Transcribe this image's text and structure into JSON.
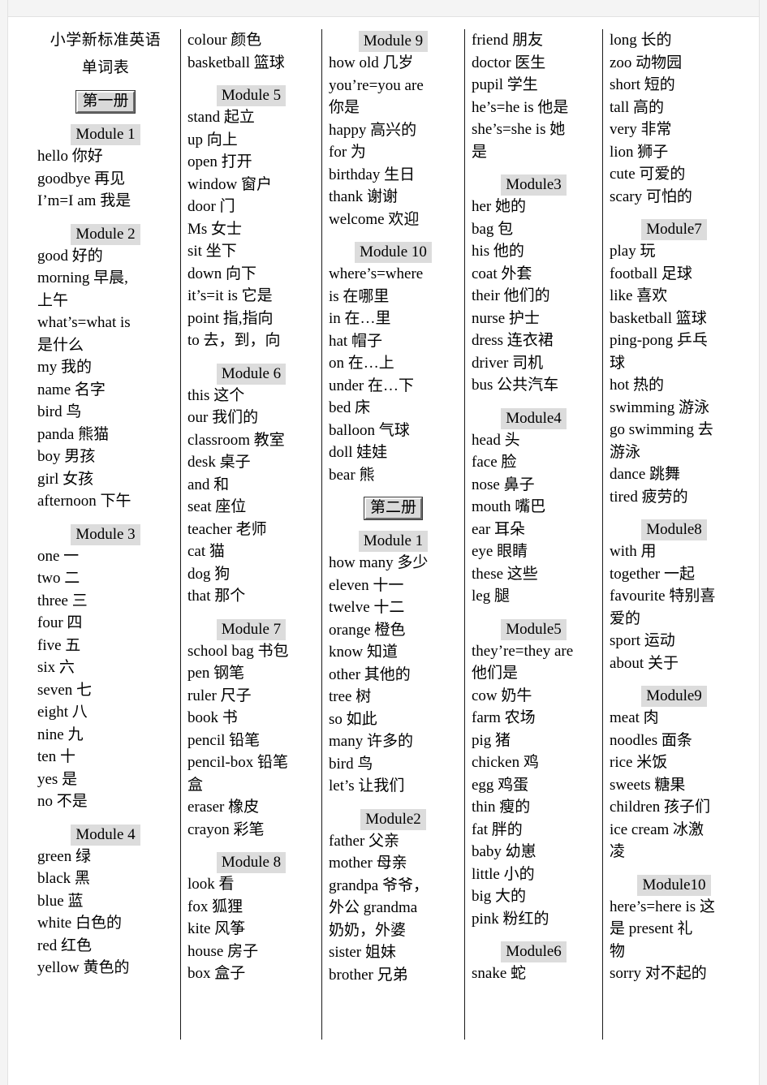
{
  "document": {
    "title_line1": "小学新标准英语",
    "title_line2": "单词表"
  },
  "volumes": {
    "book1": "第一册",
    "book2": "第二册"
  },
  "columns": [
    {
      "id": "column-1",
      "blocks": [
        {
          "type": "title"
        },
        {
          "type": "volume",
          "label": "第一册"
        },
        {
          "type": "module",
          "label": "Module  1"
        },
        {
          "type": "entry",
          "text": "hello 你好"
        },
        {
          "type": "entry",
          "text": "goodbye  再见"
        },
        {
          "type": "entry",
          "text": "I’m=I  am 我是"
        },
        {
          "type": "module",
          "label": "Module  2"
        },
        {
          "type": "entry",
          "text": "good 好的"
        },
        {
          "type": "entry",
          "text": "morning        早晨,",
          "justify": true
        },
        {
          "type": "entry",
          "text": "上午"
        },
        {
          "type": "entry",
          "text": "what’s=what    is",
          "justify": true
        },
        {
          "type": "entry",
          "text": "是什么"
        },
        {
          "type": "entry",
          "text": "my 我的"
        },
        {
          "type": "entry",
          "text": "name 名字"
        },
        {
          "type": "entry",
          "text": "bird 鸟"
        },
        {
          "type": "entry",
          "text": "panda 熊猫"
        },
        {
          "type": "entry",
          "text": "boy 男孩"
        },
        {
          "type": "entry",
          "text": "girl 女孩"
        },
        {
          "type": "entry",
          "text": "afternoon 下午"
        },
        {
          "type": "module",
          "label": "Module  3"
        },
        {
          "type": "entry",
          "text": "one   一"
        },
        {
          "type": "entry",
          "text": "two 二"
        },
        {
          "type": "entry",
          "text": "three 三"
        },
        {
          "type": "entry",
          "text": "four  四"
        },
        {
          "type": "entry",
          "text": "five 五"
        },
        {
          "type": "entry",
          "text": "six 六"
        },
        {
          "type": "entry",
          "text": "seven   七"
        },
        {
          "type": "entry",
          "text": "eight 八"
        },
        {
          "type": "entry",
          "text": "nine 九"
        },
        {
          "type": "entry",
          "text": "ten  十"
        },
        {
          "type": "entry",
          "text": "yes 是"
        },
        {
          "type": "entry",
          "text": "no 不是"
        },
        {
          "type": "module",
          "label": "Module  4"
        },
        {
          "type": "entry",
          "text": "green 绿"
        },
        {
          "type": "entry",
          "text": "black 黑"
        },
        {
          "type": "entry",
          "text": "blue 蓝"
        },
        {
          "type": "entry",
          "text": "white 白色的"
        },
        {
          "type": "entry",
          "text": "red 红色"
        },
        {
          "type": "entry",
          "text": "yellow 黄色的"
        }
      ]
    },
    {
      "id": "column-2",
      "blocks": [
        {
          "type": "entry",
          "text": "colour 颜色"
        },
        {
          "type": "entry",
          "text": "basketball 篮球"
        },
        {
          "type": "module",
          "label": "Module  5"
        },
        {
          "type": "entry",
          "text": "stand 起立"
        },
        {
          "type": "entry",
          "text": "up 向上"
        },
        {
          "type": "entry",
          "text": "open 打开"
        },
        {
          "type": "entry",
          "text": "window 窗户"
        },
        {
          "type": "entry",
          "text": "door 门"
        },
        {
          "type": "entry",
          "text": "Ms 女士"
        },
        {
          "type": "entry",
          "text": "sit 坐下"
        },
        {
          "type": "entry",
          "text": "down 向下"
        },
        {
          "type": "entry",
          "text": "it’s=it is 它是"
        },
        {
          "type": "entry",
          "text": "point 指,指向"
        },
        {
          "type": "entry",
          "text": "to 去，到，向"
        },
        {
          "type": "module",
          "label": "Module  6"
        },
        {
          "type": "entry",
          "text": "this 这个"
        },
        {
          "type": "entry",
          "text": "our 我们的"
        },
        {
          "type": "entry",
          "text": "classroom 教室"
        },
        {
          "type": "entry",
          "text": "desk 桌子"
        },
        {
          "type": "entry",
          "text": "and 和"
        },
        {
          "type": "entry",
          "text": "seat 座位"
        },
        {
          "type": "entry",
          "text": "teacher 老师"
        },
        {
          "type": "entry",
          "text": "cat 猫"
        },
        {
          "type": "entry",
          "text": "dog 狗"
        },
        {
          "type": "entry",
          "text": "that 那个"
        },
        {
          "type": "module",
          "label": "Module  7"
        },
        {
          "type": "entry",
          "text": "school bag 书包"
        },
        {
          "type": "entry",
          "text": "pen 钢笔"
        },
        {
          "type": "entry",
          "text": "ruler 尺子"
        },
        {
          "type": "entry",
          "text": "book 书"
        },
        {
          "type": "entry",
          "text": "pencil 铅笔"
        },
        {
          "type": "entry",
          "text": "pencil-box 铅笔"
        },
        {
          "type": "entry",
          "text": "盒"
        },
        {
          "type": "entry",
          "text": "eraser 橡皮"
        },
        {
          "type": "entry",
          "text": "crayon 彩笔"
        },
        {
          "type": "module",
          "label": "Module  8"
        },
        {
          "type": "entry",
          "text": "look 看"
        },
        {
          "type": "entry",
          "text": "fox 狐狸"
        },
        {
          "type": "entry",
          "text": "kite 风筝"
        },
        {
          "type": "entry",
          "text": "house 房子"
        },
        {
          "type": "entry",
          "text": "box 盒子"
        }
      ]
    },
    {
      "id": "column-3",
      "blocks": [
        {
          "type": "module",
          "label": "Module  9",
          "first": true
        },
        {
          "type": "entry",
          "text": "how old 几岁"
        },
        {
          "type": "entry",
          "text": "you’re=you     are",
          "justify": true
        },
        {
          "type": "entry",
          "text": "你是"
        },
        {
          "type": "entry",
          "text": "happy 高兴的"
        },
        {
          "type": "entry",
          "text": "for 为"
        },
        {
          "type": "entry",
          "text": "birthday 生日"
        },
        {
          "type": "entry",
          "text": "thank 谢谢"
        },
        {
          "type": "entry",
          "text": "welcome 欢迎"
        },
        {
          "type": "module",
          "label": "Module  10"
        },
        {
          "type": "entry",
          "text": "where’s=where"
        },
        {
          "type": "entry",
          "text": "is 在哪里"
        },
        {
          "type": "entry",
          "text": "in 在…里"
        },
        {
          "type": "entry",
          "text": "hat 帽子"
        },
        {
          "type": "entry",
          "text": "on 在…上"
        },
        {
          "type": "entry",
          "text": "under 在…下"
        },
        {
          "type": "entry",
          "text": "bed 床"
        },
        {
          "type": "entry",
          "text": "balloon 气球"
        },
        {
          "type": "entry",
          "text": "doll 娃娃"
        },
        {
          "type": "entry",
          "text": "bear   熊"
        },
        {
          "type": "volume",
          "label": "第二册"
        },
        {
          "type": "module",
          "label": "Module  1"
        },
        {
          "type": "entry",
          "text": "how many 多少"
        },
        {
          "type": "entry",
          "text": "eleven 十一"
        },
        {
          "type": "entry",
          "text": "twelve 十二"
        },
        {
          "type": "entry",
          "text": "orange 橙色"
        },
        {
          "type": "entry",
          "text": "know 知道"
        },
        {
          "type": "entry",
          "text": "other 其他的"
        },
        {
          "type": "entry",
          "text": "tree 树"
        },
        {
          "type": "entry",
          "text": "so 如此"
        },
        {
          "type": "entry",
          "text": "many 许多的"
        },
        {
          "type": "entry",
          "text": "bird 鸟"
        },
        {
          "type": "entry",
          "text": "let’s 让我们"
        },
        {
          "type": "module",
          "label": "Module2"
        },
        {
          "type": "entry",
          "text": "father 父亲"
        },
        {
          "type": "entry",
          "text": "mother 母亲"
        },
        {
          "type": "entry",
          "text": "grandpa 爷爷，"
        },
        {
          "type": "entry",
          "text": "外公     grandma",
          "justify": true
        },
        {
          "type": "entry",
          "text": "奶奶，外婆"
        },
        {
          "type": "entry",
          "text": "sister 姐妹"
        },
        {
          "type": "entry",
          "text": "brother 兄弟"
        }
      ]
    },
    {
      "id": "column-4",
      "blocks": [
        {
          "type": "entry",
          "text": "friend 朋友"
        },
        {
          "type": "entry",
          "text": "doctor 医生"
        },
        {
          "type": "entry",
          "text": "pupil 学生"
        },
        {
          "type": "entry",
          "text": "he’s=he is 他是"
        },
        {
          "type": "entry",
          "text": "she’s=she    is 她",
          "justify": true
        },
        {
          "type": "entry",
          "text": "是"
        },
        {
          "type": "module",
          "label": "Module3"
        },
        {
          "type": "entry",
          "text": "her 她的"
        },
        {
          "type": "entry",
          "text": "bag 包"
        },
        {
          "type": "entry",
          "text": "his 他的"
        },
        {
          "type": "entry",
          "text": "coat 外套"
        },
        {
          "type": "entry",
          "text": "their 他们的"
        },
        {
          "type": "entry",
          "text": "nurse 护士"
        },
        {
          "type": "entry",
          "text": "dress 连衣裙"
        },
        {
          "type": "entry",
          "text": "driver 司机"
        },
        {
          "type": "entry",
          "text": "bus 公共汽车"
        },
        {
          "type": "module",
          "label": "Module4"
        },
        {
          "type": "entry",
          "text": "head 头"
        },
        {
          "type": "entry",
          "text": "face 脸"
        },
        {
          "type": "entry",
          "text": "nose 鼻子"
        },
        {
          "type": "entry",
          "text": "mouth 嘴巴"
        },
        {
          "type": "entry",
          "text": "ear 耳朵"
        },
        {
          "type": "entry",
          "text": "eye 眼睛"
        },
        {
          "type": "entry",
          "text": "these 这些"
        },
        {
          "type": "entry",
          "text": "leg 腿"
        },
        {
          "type": "module",
          "label": "Module5"
        },
        {
          "type": "entry",
          "text": "they’re=they  are",
          "justify": true
        },
        {
          "type": "entry",
          "text": "他们是"
        },
        {
          "type": "entry",
          "text": "cow 奶牛"
        },
        {
          "type": "entry",
          "text": "farm 农场"
        },
        {
          "type": "entry",
          "text": "pig 猪"
        },
        {
          "type": "entry",
          "text": "chicken   鸡"
        },
        {
          "type": "entry",
          "text": "egg 鸡蛋"
        },
        {
          "type": "entry",
          "text": "thin 瘦的"
        },
        {
          "type": "entry",
          "text": "fat 胖的"
        },
        {
          "type": "entry",
          "text": "baby 幼崽"
        },
        {
          "type": "entry",
          "text": "little 小的"
        },
        {
          "type": "entry",
          "text": "big 大的"
        },
        {
          "type": "entry",
          "text": "pink 粉红的"
        },
        {
          "type": "module",
          "label": "Module6"
        },
        {
          "type": "entry",
          "text": "snake 蛇"
        }
      ]
    },
    {
      "id": "column-5",
      "blocks": [
        {
          "type": "entry",
          "text": "long 长的"
        },
        {
          "type": "entry",
          "text": "zoo 动物园"
        },
        {
          "type": "entry",
          "text": "short 短的"
        },
        {
          "type": "entry",
          "text": "tall 高的"
        },
        {
          "type": "entry",
          "text": "very 非常"
        },
        {
          "type": "entry",
          "text": "lion 狮子"
        },
        {
          "type": "entry",
          "text": "cute 可爱的"
        },
        {
          "type": "entry",
          "text": "scary 可怕的"
        },
        {
          "type": "module",
          "label": "Module7"
        },
        {
          "type": "entry",
          "text": "play 玩"
        },
        {
          "type": "entry",
          "text": "football 足球"
        },
        {
          "type": "entry",
          "text": "like 喜欢"
        },
        {
          "type": "entry",
          "text": "basketball 篮球"
        },
        {
          "type": "entry",
          "text": "ping-pong 乒乓"
        },
        {
          "type": "entry",
          "text": "球"
        },
        {
          "type": "entry",
          "text": "hot 热的"
        },
        {
          "type": "entry",
          "text": "swimming 游泳"
        },
        {
          "type": "entry",
          "text": "go  swimming 去",
          "justify": true
        },
        {
          "type": "entry",
          "text": "游泳"
        },
        {
          "type": "entry",
          "text": "dance 跳舞"
        },
        {
          "type": "entry",
          "text": "tired 疲劳的"
        },
        {
          "type": "module",
          "label": "Module8"
        },
        {
          "type": "entry",
          "text": "with 用"
        },
        {
          "type": "entry",
          "text": "together 一起"
        },
        {
          "type": "entry",
          "text": "favourite 特别喜"
        },
        {
          "type": "entry",
          "text": "爱的"
        },
        {
          "type": "entry",
          "text": "sport 运动"
        },
        {
          "type": "entry",
          "text": "about 关于"
        },
        {
          "type": "module",
          "label": "Module9"
        },
        {
          "type": "entry",
          "text": "meat 肉"
        },
        {
          "type": "entry",
          "text": "noodles 面条"
        },
        {
          "type": "entry",
          "text": "rice 米饭"
        },
        {
          "type": "entry",
          "text": "sweets 糖果"
        },
        {
          "type": "entry",
          "text": "children 孩子们"
        },
        {
          "type": "entry",
          "text": "ice    cream 冰激",
          "justify": true
        },
        {
          "type": "entry",
          "text": "凌"
        },
        {
          "type": "module",
          "label": "Module10"
        },
        {
          "type": "entry",
          "text": "here’s=here  is 这",
          "justify": true
        },
        {
          "type": "entry",
          "text": "是      present 礼",
          "justify": true
        },
        {
          "type": "entry",
          "text": "物"
        },
        {
          "type": "entry",
          "text": "sorry 对不起的"
        }
      ]
    }
  ]
}
